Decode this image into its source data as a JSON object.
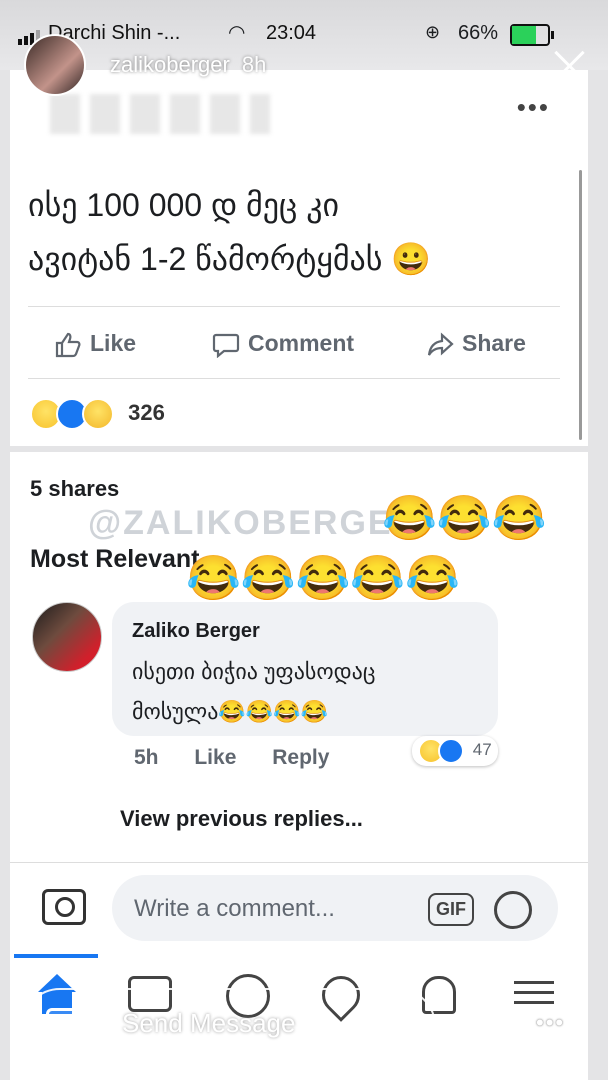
{
  "status_bar": {
    "carrier": "Darchi Shin -...",
    "time": "23:04",
    "battery": "66%",
    "battery_level": 0.66
  },
  "story": {
    "username": "zalikoberger",
    "age": "8h",
    "send_message_placeholder": "Send Message"
  },
  "post": {
    "text_line1": "ისე 100 000 დ მეც კი",
    "text_line2": "ავიტან 1-2 წამორტყმას 😀",
    "actions": {
      "like": "Like",
      "comment": "Comment",
      "share": "Share"
    },
    "reaction_count": "326",
    "shares": "5 shares",
    "watermark": "@ZALIKOBERGER",
    "sort_label": "Most Relevant",
    "overlay_emojis_row1": "😂😂😂",
    "overlay_emojis_row2": "😂😂😂😂😂"
  },
  "comment": {
    "author": "Zaliko Berger",
    "text_line1": "ისეთი ბიჭია უფასოდაც",
    "text_line2": "მოსულა😂😂😂😂",
    "time": "5h",
    "like": "Like",
    "reply": "Reply",
    "reaction_count": "47",
    "view_previous": "View previous replies..."
  },
  "composer": {
    "placeholder": "Write a comment...",
    "gif": "GIF"
  },
  "icons": [
    "camera-icon",
    "gif-icon",
    "smiley-icon",
    "home-icon",
    "video-icon",
    "groups-icon",
    "pages-icon",
    "bell-icon",
    "menu-icon",
    "send-icon"
  ]
}
